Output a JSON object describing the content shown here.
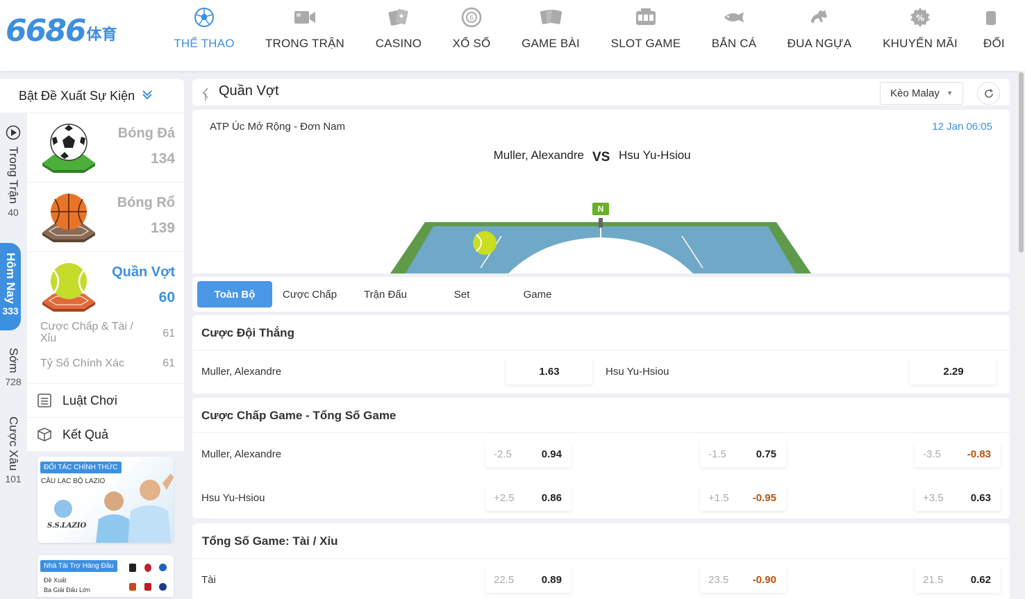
{
  "header": {
    "logo_number": "6686",
    "logo_suffix": "体育",
    "nav": [
      {
        "label": "THỂ THAO",
        "icon": "soccer-ball-icon",
        "active": true
      },
      {
        "label": "TRONG TRẬN",
        "icon": "video-camera-icon"
      },
      {
        "label": "CASINO",
        "icon": "playing-cards-icon"
      },
      {
        "label": "XỔ SỐ",
        "icon": "lottery-ball-icon"
      },
      {
        "label": "GAME BÀI",
        "icon": "card-game-icon"
      },
      {
        "label": "SLOT GAME",
        "icon": "slot-machine-icon"
      },
      {
        "label": "BẮN CÁ",
        "icon": "fish-icon"
      },
      {
        "label": "ĐUA NGỰA",
        "icon": "horse-icon"
      },
      {
        "label": "KHUYẾN MÃI",
        "icon": "discount-badge-icon"
      },
      {
        "label": "ĐỐI",
        "icon": "partner-icon"
      }
    ]
  },
  "rail": {
    "items": [
      {
        "label": "Trong Trận",
        "count": "40"
      },
      {
        "label": "Hôm Nay",
        "count": "333",
        "active": true
      },
      {
        "label": "Sớm",
        "count": "728"
      },
      {
        "label": "Cược Xâu",
        "count": "101"
      }
    ]
  },
  "sidebar": {
    "suggest_label": "Bật Đề Xuất Sự Kiện",
    "sports": [
      {
        "name": "Bóng Đá",
        "count": "134"
      },
      {
        "name": "Bóng Rổ",
        "count": "139"
      },
      {
        "name": "Quần Vợt",
        "count": "60",
        "active": true
      }
    ],
    "subitems": [
      {
        "label": "Cược Chấp & Tài / Xỉu",
        "count": "61"
      },
      {
        "label": "Tỷ Số Chính Xác",
        "count": "61"
      }
    ],
    "rules_label": "Luật Chơi",
    "results_label": "Kết Quả",
    "promo1": {
      "badge": "ĐỐI TÁC CHÍNH THỨC",
      "subtitle": "CÂU LẠC BỘ LAZIO",
      "logo_text": "S.S.LAZIO"
    },
    "promo2": {
      "badge": "Nhà Tài Trợ Hàng Đầu",
      "line1": "Đề Xuất",
      "line2": "Ba Giải Đấu Lớn"
    }
  },
  "main": {
    "title": "Quần Vợt",
    "odds_type": "Kèo Malay",
    "match": {
      "league": "ATP Úc Mở Rộng - Đơn Nam",
      "kickoff": "12 Jan 06:05",
      "home": "Muller, Alexandre",
      "vs": "VS",
      "away": "Hsu Yu-Hsiou",
      "neutral": "N"
    },
    "tabs": [
      "Toàn Bộ",
      "Cược Chấp",
      "Trận Đấu",
      "Set",
      "Game"
    ],
    "moneyline": {
      "title": "Cược Đội Thắng",
      "home": "Muller, Alexandre",
      "home_odd": "1.63",
      "away": "Hsu Yu-Hsiou",
      "away_odd": "2.29"
    },
    "handicap": {
      "title": "Cược Chấp Game - Tổng Số Game",
      "rows": [
        {
          "team": "Muller, Alexandre",
          "odds": [
            {
              "line": "-2.5",
              "val": "0.94"
            },
            {
              "line": "-1.5",
              "val": "0.75"
            },
            {
              "line": "-3.5",
              "val": "-0.83"
            }
          ]
        },
        {
          "team": "Hsu Yu-Hsiou",
          "odds": [
            {
              "line": "+2.5",
              "val": "0.86"
            },
            {
              "line": "+1.5",
              "val": "-0.95"
            },
            {
              "line": "+3.5",
              "val": "0.63"
            }
          ]
        }
      ]
    },
    "total": {
      "title": "Tổng Số Game: Tài / Xỉu",
      "rows": [
        {
          "team": "Tài",
          "odds": [
            {
              "line": "22.5",
              "val": "0.89"
            },
            {
              "line": "23.5",
              "val": "-0.90"
            },
            {
              "line": "21.5",
              "val": "0.62"
            }
          ]
        }
      ]
    }
  },
  "colors": {
    "accent": "#3d8fe0",
    "negative": "#b4530b",
    "neutral_badge": "#6ab023"
  }
}
